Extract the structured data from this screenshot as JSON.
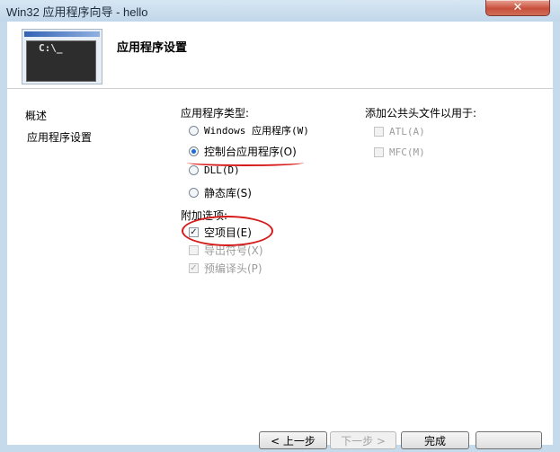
{
  "window": {
    "title": "Win32 应用程序向导 - hello",
    "close_glyph": "✕"
  },
  "header": {
    "page_title": "应用程序设置",
    "wizard_prompt": "C:\\_"
  },
  "nav": {
    "items": [
      "概述",
      "应用程序设置"
    ]
  },
  "app_type": {
    "label": "应用程序类型:",
    "options": [
      {
        "label": "Windows 应用程序(W)",
        "checked": false
      },
      {
        "label": "控制台应用程序(O)",
        "checked": true
      },
      {
        "label": "DLL(D)",
        "checked": false
      },
      {
        "label": "静态库(S)",
        "checked": false
      }
    ]
  },
  "extra": {
    "label": "附加选项:",
    "options": [
      {
        "label": "空项目(E)",
        "checked": true,
        "enabled": true
      },
      {
        "label": "导出符号(X)",
        "checked": false,
        "enabled": false
      },
      {
        "label": "预编译头(P)",
        "checked": true,
        "enabled": false
      }
    ]
  },
  "common_headers": {
    "label": "添加公共头文件以用于:",
    "options": [
      {
        "label": "ATL(A)",
        "checked": false,
        "enabled": false
      },
      {
        "label": "MFC(M)",
        "checked": false,
        "enabled": false
      }
    ]
  },
  "buttons": {
    "back": "< 上一步",
    "next": "下一步 >",
    "finish": "完成",
    "cancel": ""
  },
  "colors": {
    "annotation": "#d61a1a",
    "window_chrome": "#c5daea"
  }
}
